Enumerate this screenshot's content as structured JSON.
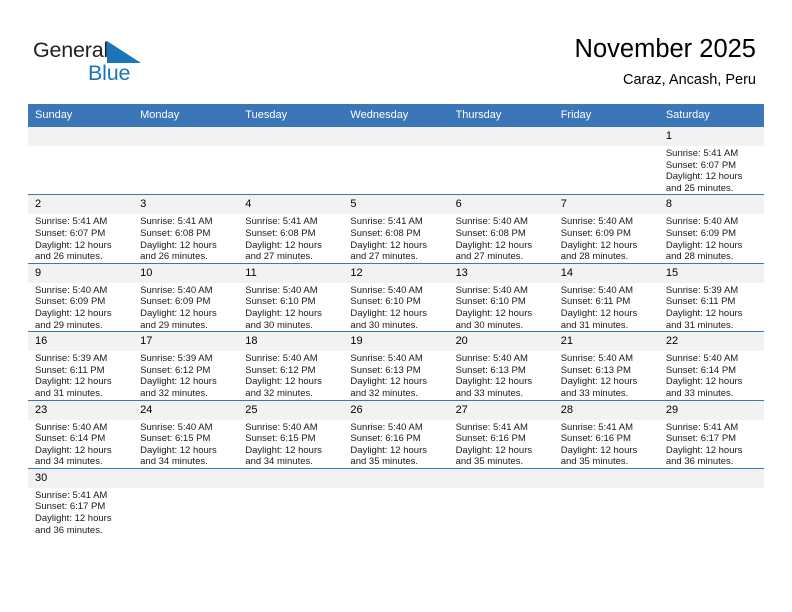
{
  "brand": {
    "name_top": "General",
    "name_bottom": "Blue",
    "color_top": "#231f20",
    "color_bottom": "#1b75bb",
    "flag_icon": "blue-triangle-flag-icon"
  },
  "header": {
    "title": "November 2025",
    "subtitle": "Caraz, Ancash, Peru"
  },
  "theme": {
    "header_bg": "#3a76b8",
    "daynum_bg": "#f2f2f2",
    "grid_line": "#3a76b8",
    "text": "#000000"
  },
  "weekdays": [
    "Sunday",
    "Monday",
    "Tuesday",
    "Wednesday",
    "Thursday",
    "Friday",
    "Saturday"
  ],
  "labels": {
    "sunrise": "Sunrise:",
    "sunset": "Sunset:",
    "daylight": "Daylight:"
  },
  "weeks": [
    [
      {
        "day": "",
        "sunrise": "",
        "sunset": "",
        "daylight_a": "",
        "daylight_b": "",
        "empty": true
      },
      {
        "day": "",
        "sunrise": "",
        "sunset": "",
        "daylight_a": "",
        "daylight_b": "",
        "empty": true
      },
      {
        "day": "",
        "sunrise": "",
        "sunset": "",
        "daylight_a": "",
        "daylight_b": "",
        "empty": true
      },
      {
        "day": "",
        "sunrise": "",
        "sunset": "",
        "daylight_a": "",
        "daylight_b": "",
        "empty": true
      },
      {
        "day": "",
        "sunrise": "",
        "sunset": "",
        "daylight_a": "",
        "daylight_b": "",
        "empty": true
      },
      {
        "day": "",
        "sunrise": "",
        "sunset": "",
        "daylight_a": "",
        "daylight_b": "",
        "empty": true
      },
      {
        "day": "1",
        "sunrise": "Sunrise: 5:41 AM",
        "sunset": "Sunset: 6:07 PM",
        "daylight_a": "Daylight: 12 hours",
        "daylight_b": "and 25 minutes.",
        "empty": false
      }
    ],
    [
      {
        "day": "2",
        "sunrise": "Sunrise: 5:41 AM",
        "sunset": "Sunset: 6:07 PM",
        "daylight_a": "Daylight: 12 hours",
        "daylight_b": "and 26 minutes.",
        "empty": false
      },
      {
        "day": "3",
        "sunrise": "Sunrise: 5:41 AM",
        "sunset": "Sunset: 6:08 PM",
        "daylight_a": "Daylight: 12 hours",
        "daylight_b": "and 26 minutes.",
        "empty": false
      },
      {
        "day": "4",
        "sunrise": "Sunrise: 5:41 AM",
        "sunset": "Sunset: 6:08 PM",
        "daylight_a": "Daylight: 12 hours",
        "daylight_b": "and 27 minutes.",
        "empty": false
      },
      {
        "day": "5",
        "sunrise": "Sunrise: 5:41 AM",
        "sunset": "Sunset: 6:08 PM",
        "daylight_a": "Daylight: 12 hours",
        "daylight_b": "and 27 minutes.",
        "empty": false
      },
      {
        "day": "6",
        "sunrise": "Sunrise: 5:40 AM",
        "sunset": "Sunset: 6:08 PM",
        "daylight_a": "Daylight: 12 hours",
        "daylight_b": "and 27 minutes.",
        "empty": false
      },
      {
        "day": "7",
        "sunrise": "Sunrise: 5:40 AM",
        "sunset": "Sunset: 6:09 PM",
        "daylight_a": "Daylight: 12 hours",
        "daylight_b": "and 28 minutes.",
        "empty": false
      },
      {
        "day": "8",
        "sunrise": "Sunrise: 5:40 AM",
        "sunset": "Sunset: 6:09 PM",
        "daylight_a": "Daylight: 12 hours",
        "daylight_b": "and 28 minutes.",
        "empty": false
      }
    ],
    [
      {
        "day": "9",
        "sunrise": "Sunrise: 5:40 AM",
        "sunset": "Sunset: 6:09 PM",
        "daylight_a": "Daylight: 12 hours",
        "daylight_b": "and 29 minutes.",
        "empty": false
      },
      {
        "day": "10",
        "sunrise": "Sunrise: 5:40 AM",
        "sunset": "Sunset: 6:09 PM",
        "daylight_a": "Daylight: 12 hours",
        "daylight_b": "and 29 minutes.",
        "empty": false
      },
      {
        "day": "11",
        "sunrise": "Sunrise: 5:40 AM",
        "sunset": "Sunset: 6:10 PM",
        "daylight_a": "Daylight: 12 hours",
        "daylight_b": "and 30 minutes.",
        "empty": false
      },
      {
        "day": "12",
        "sunrise": "Sunrise: 5:40 AM",
        "sunset": "Sunset: 6:10 PM",
        "daylight_a": "Daylight: 12 hours",
        "daylight_b": "and 30 minutes.",
        "empty": false
      },
      {
        "day": "13",
        "sunrise": "Sunrise: 5:40 AM",
        "sunset": "Sunset: 6:10 PM",
        "daylight_a": "Daylight: 12 hours",
        "daylight_b": "and 30 minutes.",
        "empty": false
      },
      {
        "day": "14",
        "sunrise": "Sunrise: 5:40 AM",
        "sunset": "Sunset: 6:11 PM",
        "daylight_a": "Daylight: 12 hours",
        "daylight_b": "and 31 minutes.",
        "empty": false
      },
      {
        "day": "15",
        "sunrise": "Sunrise: 5:39 AM",
        "sunset": "Sunset: 6:11 PM",
        "daylight_a": "Daylight: 12 hours",
        "daylight_b": "and 31 minutes.",
        "empty": false
      }
    ],
    [
      {
        "day": "16",
        "sunrise": "Sunrise: 5:39 AM",
        "sunset": "Sunset: 6:11 PM",
        "daylight_a": "Daylight: 12 hours",
        "daylight_b": "and 31 minutes.",
        "empty": false
      },
      {
        "day": "17",
        "sunrise": "Sunrise: 5:39 AM",
        "sunset": "Sunset: 6:12 PM",
        "daylight_a": "Daylight: 12 hours",
        "daylight_b": "and 32 minutes.",
        "empty": false
      },
      {
        "day": "18",
        "sunrise": "Sunrise: 5:40 AM",
        "sunset": "Sunset: 6:12 PM",
        "daylight_a": "Daylight: 12 hours",
        "daylight_b": "and 32 minutes.",
        "empty": false
      },
      {
        "day": "19",
        "sunrise": "Sunrise: 5:40 AM",
        "sunset": "Sunset: 6:13 PM",
        "daylight_a": "Daylight: 12 hours",
        "daylight_b": "and 32 minutes.",
        "empty": false
      },
      {
        "day": "20",
        "sunrise": "Sunrise: 5:40 AM",
        "sunset": "Sunset: 6:13 PM",
        "daylight_a": "Daylight: 12 hours",
        "daylight_b": "and 33 minutes.",
        "empty": false
      },
      {
        "day": "21",
        "sunrise": "Sunrise: 5:40 AM",
        "sunset": "Sunset: 6:13 PM",
        "daylight_a": "Daylight: 12 hours",
        "daylight_b": "and 33 minutes.",
        "empty": false
      },
      {
        "day": "22",
        "sunrise": "Sunrise: 5:40 AM",
        "sunset": "Sunset: 6:14 PM",
        "daylight_a": "Daylight: 12 hours",
        "daylight_b": "and 33 minutes.",
        "empty": false
      }
    ],
    [
      {
        "day": "23",
        "sunrise": "Sunrise: 5:40 AM",
        "sunset": "Sunset: 6:14 PM",
        "daylight_a": "Daylight: 12 hours",
        "daylight_b": "and 34 minutes.",
        "empty": false
      },
      {
        "day": "24",
        "sunrise": "Sunrise: 5:40 AM",
        "sunset": "Sunset: 6:15 PM",
        "daylight_a": "Daylight: 12 hours",
        "daylight_b": "and 34 minutes.",
        "empty": false
      },
      {
        "day": "25",
        "sunrise": "Sunrise: 5:40 AM",
        "sunset": "Sunset: 6:15 PM",
        "daylight_a": "Daylight: 12 hours",
        "daylight_b": "and 34 minutes.",
        "empty": false
      },
      {
        "day": "26",
        "sunrise": "Sunrise: 5:40 AM",
        "sunset": "Sunset: 6:16 PM",
        "daylight_a": "Daylight: 12 hours",
        "daylight_b": "and 35 minutes.",
        "empty": false
      },
      {
        "day": "27",
        "sunrise": "Sunrise: 5:41 AM",
        "sunset": "Sunset: 6:16 PM",
        "daylight_a": "Daylight: 12 hours",
        "daylight_b": "and 35 minutes.",
        "empty": false
      },
      {
        "day": "28",
        "sunrise": "Sunrise: 5:41 AM",
        "sunset": "Sunset: 6:16 PM",
        "daylight_a": "Daylight: 12 hours",
        "daylight_b": "and 35 minutes.",
        "empty": false
      },
      {
        "day": "29",
        "sunrise": "Sunrise: 5:41 AM",
        "sunset": "Sunset: 6:17 PM",
        "daylight_a": "Daylight: 12 hours",
        "daylight_b": "and 36 minutes.",
        "empty": false
      }
    ],
    [
      {
        "day": "30",
        "sunrise": "Sunrise: 5:41 AM",
        "sunset": "Sunset: 6:17 PM",
        "daylight_a": "Daylight: 12 hours",
        "daylight_b": "and 36 minutes.",
        "empty": false
      },
      {
        "day": "",
        "sunrise": "",
        "sunset": "",
        "daylight_a": "",
        "daylight_b": "",
        "empty": true
      },
      {
        "day": "",
        "sunrise": "",
        "sunset": "",
        "daylight_a": "",
        "daylight_b": "",
        "empty": true
      },
      {
        "day": "",
        "sunrise": "",
        "sunset": "",
        "daylight_a": "",
        "daylight_b": "",
        "empty": true
      },
      {
        "day": "",
        "sunrise": "",
        "sunset": "",
        "daylight_a": "",
        "daylight_b": "",
        "empty": true
      },
      {
        "day": "",
        "sunrise": "",
        "sunset": "",
        "daylight_a": "",
        "daylight_b": "",
        "empty": true
      },
      {
        "day": "",
        "sunrise": "",
        "sunset": "",
        "daylight_a": "",
        "daylight_b": "",
        "empty": true
      }
    ]
  ]
}
